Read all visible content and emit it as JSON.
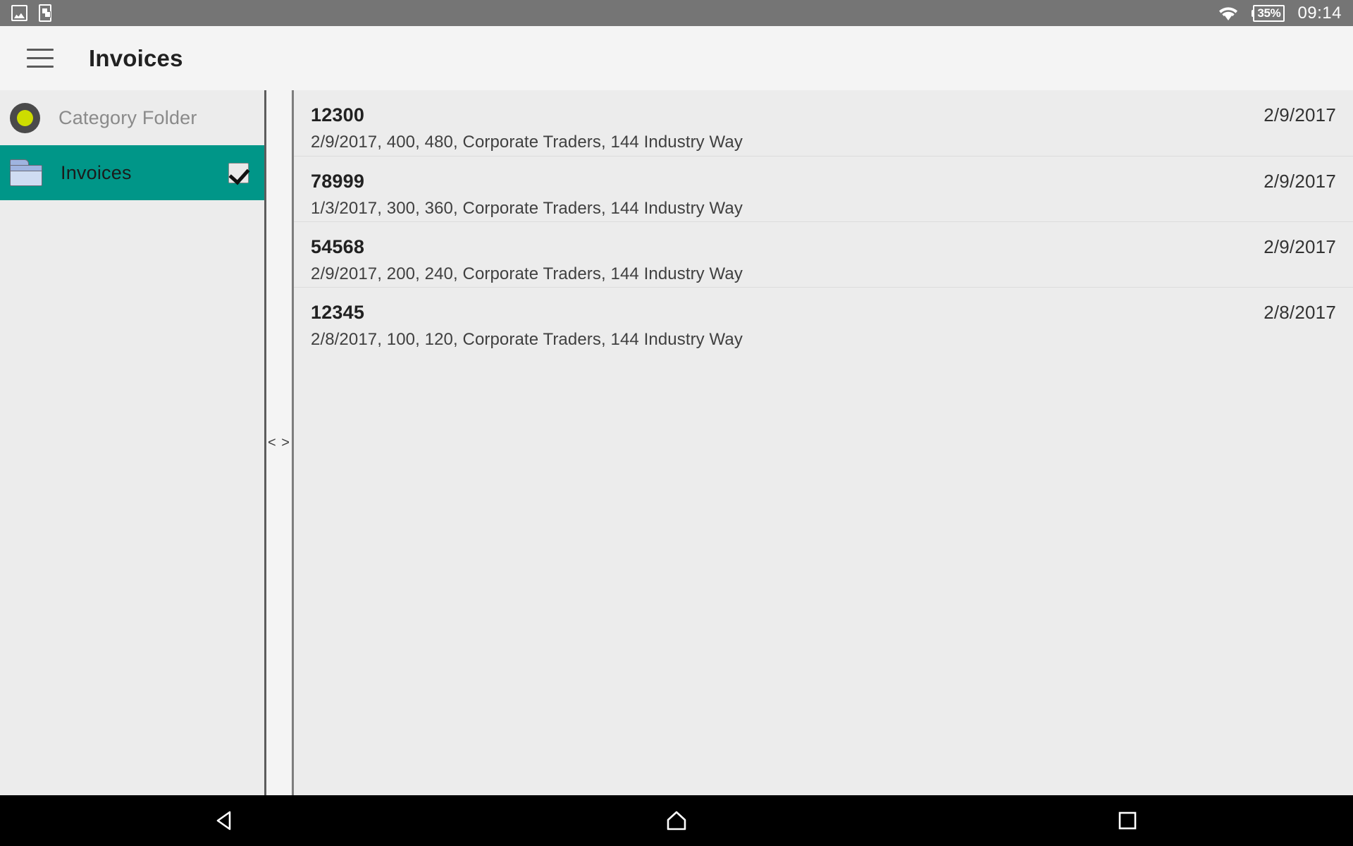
{
  "statusbar": {
    "left_icons": [
      {
        "name": "screenshot-icon",
        "glyph": "photo"
      },
      {
        "name": "app-switch-icon",
        "glyph": "phone"
      }
    ],
    "wifi_icon": "wifi-icon",
    "battery_level": "35%",
    "time": "09:14",
    "background_color": "#757575"
  },
  "appbar": {
    "menu_icon": "hamburger-menu-icon",
    "title": "Invoices",
    "background_color": "#f4f4f4"
  },
  "sidebar": {
    "items": [
      {
        "label": "Category Folder",
        "icon": "category-circle-icon",
        "selected": false,
        "checked": false
      },
      {
        "label": "Invoices",
        "icon": "folder-icon",
        "selected": true,
        "checked": true
      }
    ],
    "selected_color": "#009688",
    "background_color": "#ececec"
  },
  "splitter": {
    "handle_label": "< >"
  },
  "list": {
    "rows": [
      {
        "title": "12300",
        "subtitle": "2/9/2017, 400, 480, Corporate Traders, 144 Industry Way",
        "date": "2/9/2017"
      },
      {
        "title": "78999",
        "subtitle": "1/3/2017, 300, 360, Corporate Traders, 144 Industry Way",
        "date": "2/9/2017"
      },
      {
        "title": "54568",
        "subtitle": "2/9/2017, 200, 240, Corporate Traders, 144 Industry Way",
        "date": "2/9/2017"
      },
      {
        "title": "12345",
        "subtitle": "2/8/2017, 100, 120, Corporate Traders, 144 Industry Way",
        "date": "2/8/2017"
      }
    ]
  },
  "navbar": {
    "buttons": [
      {
        "name": "back-button",
        "icon": "back-triangle-icon"
      },
      {
        "name": "home-button",
        "icon": "home-icon"
      },
      {
        "name": "recents-button",
        "icon": "recents-square-icon"
      }
    ],
    "background_color": "#000000"
  }
}
